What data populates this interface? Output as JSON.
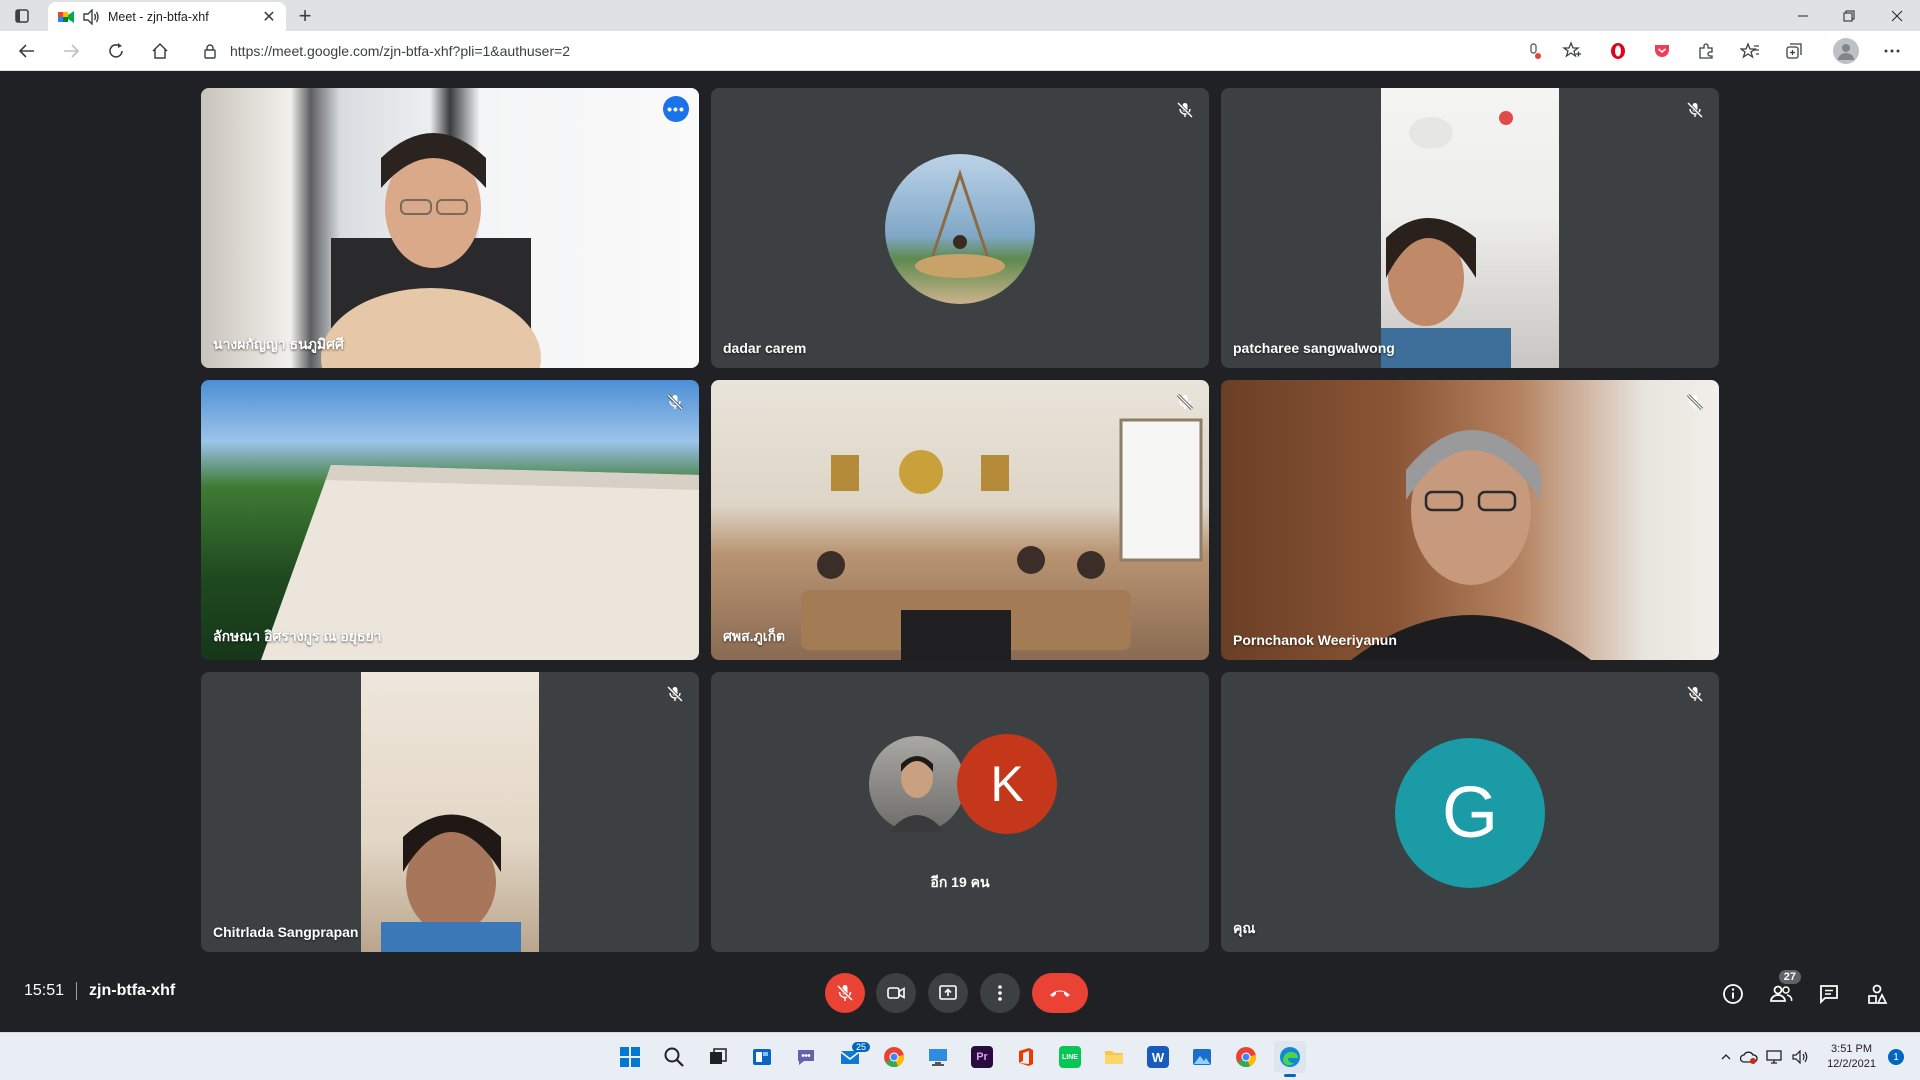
{
  "browser": {
    "tab_title": "Meet - zjn-btfa-xhf",
    "url": "https://meet.google.com/zjn-btfa-xhf?pli=1&authuser=2"
  },
  "tiles": {
    "t1": {
      "name": "นางผกัญญา ธนภูมิศศี",
      "muted": false,
      "active": true
    },
    "t2": {
      "name": "dadar carem",
      "muted": true
    },
    "t3": {
      "name": "patcharee sangwalwong",
      "muted": true
    },
    "t4": {
      "name": "ลักษณา อิศรางกูร ณ อยุธยา",
      "muted": true
    },
    "t5": {
      "name": "ศพส.ภูเก็ต",
      "muted": true
    },
    "t6": {
      "name": "Pornchanok Weeriyanun",
      "muted": true
    },
    "t7": {
      "name": "Chitrlada Sangprapan",
      "muted": true
    },
    "t8": {
      "others_label": "อีก 19 คน",
      "avatar_letter": "K"
    },
    "t9": {
      "name": "คุณ",
      "avatar_letter": "G",
      "muted": true
    }
  },
  "meeting": {
    "time": "15:51",
    "code": "zjn-btfa-xhf",
    "participants_count": "27"
  },
  "taskbar": {
    "mail_badge": "25",
    "clock_time": "3:51 PM",
    "clock_date": "12/2/2021",
    "notifications": "1"
  },
  "colors": {
    "meet_bg": "#202124",
    "tile_bg": "#3c4043",
    "leave_red": "#ea4335",
    "active_outline": "#8ab4f8",
    "avatar_k": "#c5371b",
    "avatar_g": "#1a9ba6"
  }
}
